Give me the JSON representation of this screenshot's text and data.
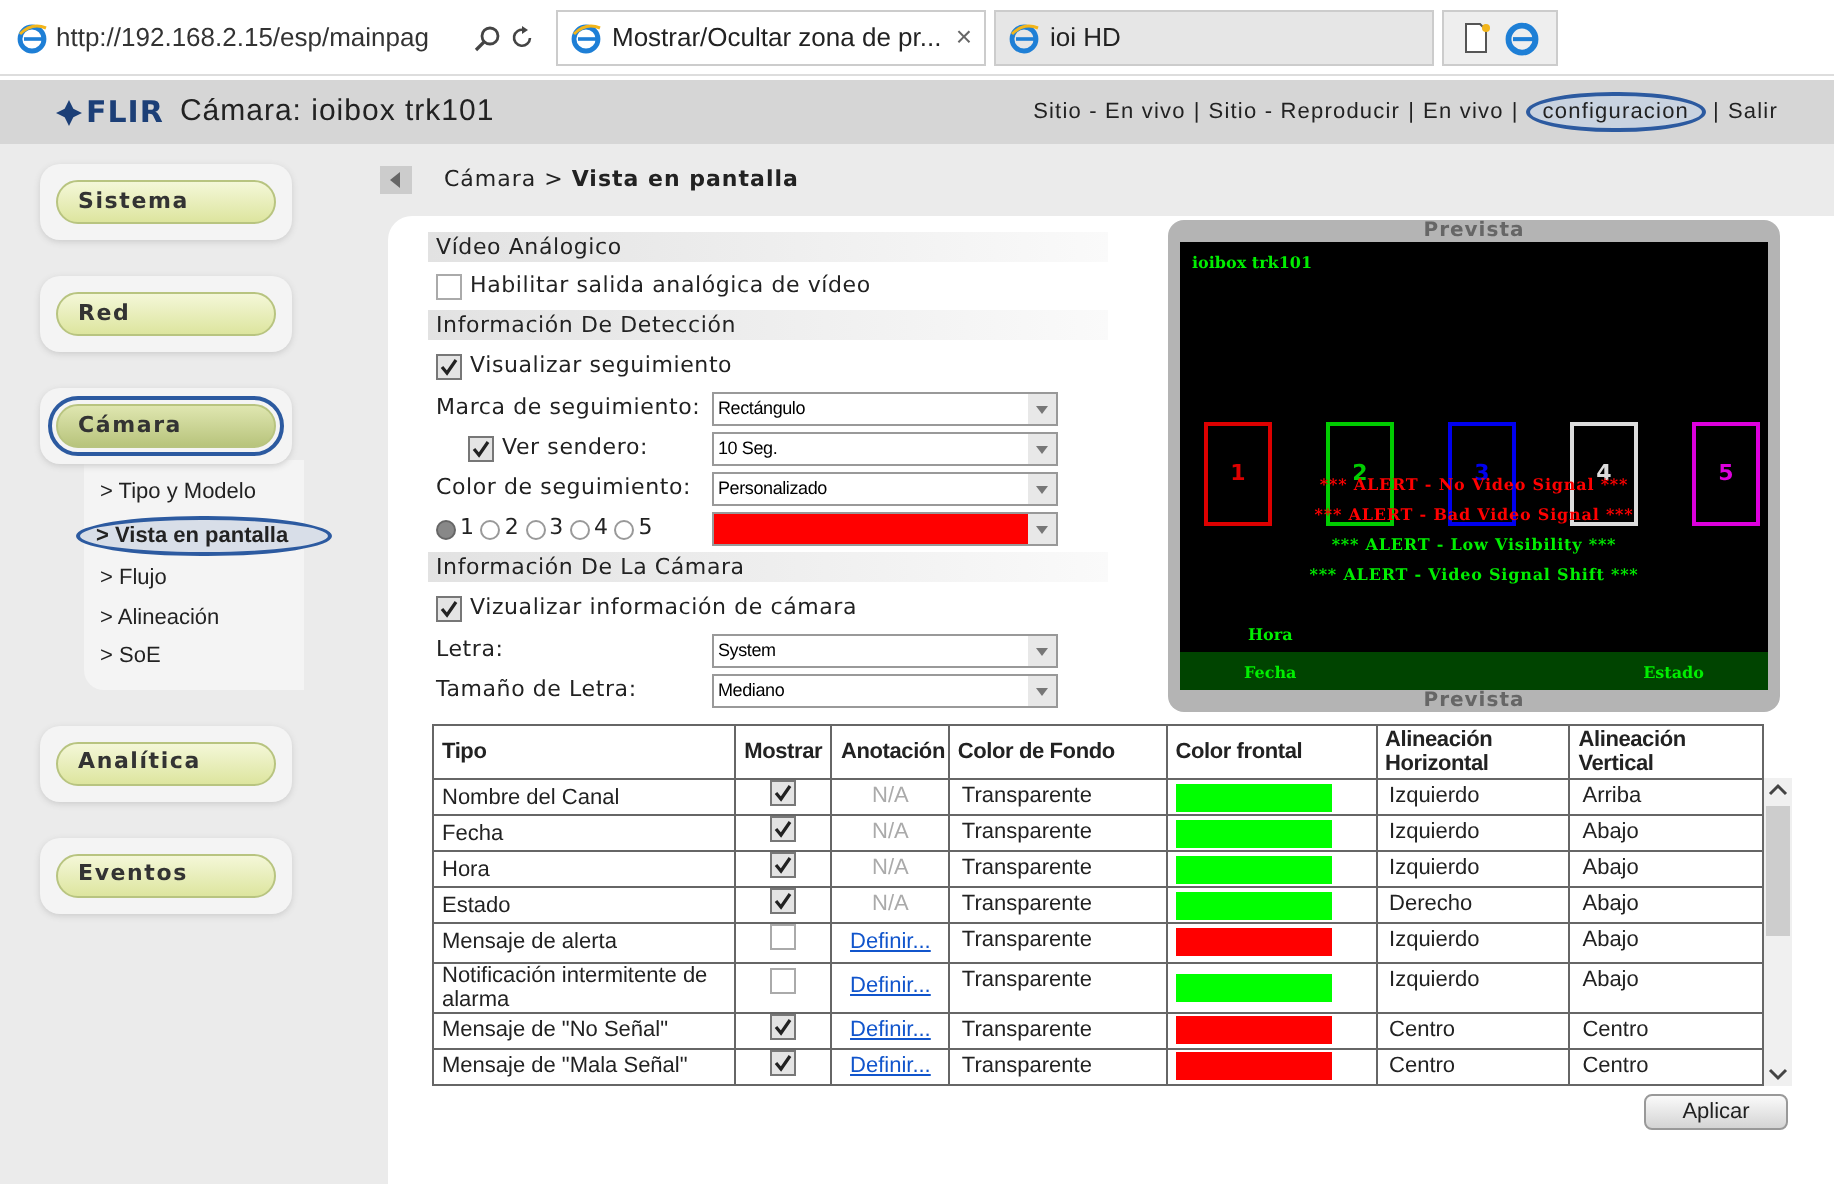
{
  "browser": {
    "address": "http://192.168.2.15/esp/mainpag",
    "tabs": [
      {
        "title": "Mostrar/Ocultar zona de pr...",
        "close": "×",
        "selected": true
      },
      {
        "title": "ioi HD",
        "selected": false
      }
    ]
  },
  "header": {
    "logo": "FLIR",
    "title": "Cámara: ioibox trk101",
    "separator": "|",
    "nav": [
      {
        "label": "Sitio - En vivo",
        "selected": false
      },
      {
        "label": "Sitio - Reproducir",
        "selected": false
      },
      {
        "label": "En vivo",
        "selected": false
      },
      {
        "label": "configuracion",
        "selected": true
      },
      {
        "label": "Salir",
        "selected": false
      }
    ]
  },
  "sidebar": {
    "items": [
      {
        "label": "Sistema",
        "selected": false
      },
      {
        "label": "Red",
        "selected": false
      },
      {
        "label": "Cámara",
        "selected": true,
        "children": [
          {
            "label": "Tipo y Modelo",
            "selected": false
          },
          {
            "label": "Vista en pantalla",
            "selected": true
          },
          {
            "label": "Flujo",
            "selected": false
          },
          {
            "label": "Alineación",
            "selected": false
          },
          {
            "label": "SoE",
            "selected": false
          }
        ]
      },
      {
        "label": "Analítica",
        "selected": false
      },
      {
        "label": "Eventos",
        "selected": false
      }
    ],
    "bullet": ">"
  },
  "breadcrumb": {
    "parent": "Cámara >",
    "current": "Vista en pantalla"
  },
  "analog": {
    "title": "Vídeo Análogico",
    "enable": {
      "label": "Habilitar salida analógica de vídeo",
      "checked": false
    }
  },
  "detection": {
    "title": "Información De Detección",
    "show_tracking": {
      "label": "Visualizar seguimiento",
      "checked": true
    },
    "mark": {
      "label": "Marca de seguimiento:",
      "value": "Rectángulo"
    },
    "trail": {
      "label": "Ver sendero:",
      "checked": true,
      "value": "10 Seg."
    },
    "color": {
      "label": "Color de seguimiento:",
      "value": "Personalizado"
    },
    "radios": [
      {
        "label": "1",
        "selected": true
      },
      {
        "label": "2",
        "selected": false
      },
      {
        "label": "3",
        "selected": false
      },
      {
        "label": "4",
        "selected": false
      },
      {
        "label": "5",
        "selected": false
      }
    ],
    "swatch": {
      "color": "#ff0000"
    }
  },
  "camera_info": {
    "title": "Información De La Cámara",
    "show": {
      "label": "Vizualizar información de cámara",
      "checked": true
    },
    "font": {
      "label": "Letra:",
      "value": "System"
    },
    "size": {
      "label": "Tamaño de Letra:",
      "value": "Mediano"
    }
  },
  "preview": {
    "title": "Prevista",
    "bottom_title": "Prevista",
    "channel_name": "ioibox trk101",
    "boxes": [
      {
        "label": "1",
        "color": "#dd0000"
      },
      {
        "label": "2",
        "color": "#00cc00"
      },
      {
        "label": "3",
        "color": "#0000ee"
      },
      {
        "label": "4",
        "color": "#dddddd"
      },
      {
        "label": "5",
        "color": "#dd00dd"
      }
    ],
    "alerts": [
      {
        "text": "*** ALERT - No Video Signal ***",
        "color": "#ff0000"
      },
      {
        "text": "*** ALERT - Bad Video Signal ***",
        "color": "#ff0000"
      },
      {
        "text": "*** ALERT - Low Visibility ***",
        "color": "#00ee00"
      },
      {
        "text": "*** ALERT - Video Signal Shift ***",
        "color": "#00ee00"
      }
    ],
    "hora": "Hora",
    "fecha": "Fecha",
    "estado": "Estado"
  },
  "table": {
    "columns": [
      "Tipo",
      "Mostrar",
      "Anotación",
      "Color de Fondo",
      "Color frontal",
      "Alineación Horizontal",
      "Alineación Vertical"
    ],
    "rows": [
      {
        "tipo": "Nombre del Canal",
        "checked": true,
        "annotation": {
          "kind": "na",
          "text": "N/A"
        },
        "background": "Transparente",
        "color": "#00ff00",
        "horizontal": "Izquierdo",
        "vertical": "Arriba"
      },
      {
        "tipo": "Fecha",
        "checked": true,
        "annotation": {
          "kind": "na",
          "text": "N/A"
        },
        "background": "Transparente",
        "color": "#00ff00",
        "horizontal": "Izquierdo",
        "vertical": "Abajo"
      },
      {
        "tipo": "Hora",
        "checked": true,
        "annotation": {
          "kind": "na",
          "text": "N/A"
        },
        "background": "Transparente",
        "color": "#00ff00",
        "horizontal": "Izquierdo",
        "vertical": "Abajo"
      },
      {
        "tipo": "Estado",
        "checked": true,
        "annotation": {
          "kind": "na",
          "text": "N/A"
        },
        "background": "Transparente",
        "color": "#00ff00",
        "horizontal": "Derecho",
        "vertical": "Abajo"
      },
      {
        "tipo": "Mensaje de alerta",
        "checked": false,
        "annotation": {
          "kind": "link",
          "text": "Definir..."
        },
        "background": "Transparente",
        "color": "#ff0000",
        "horizontal": "Izquierdo",
        "vertical": "Abajo"
      },
      {
        "tipo": "Notificación intermitente de alarma",
        "checked": false,
        "annotation": {
          "kind": "link",
          "text": "Definir..."
        },
        "background": "Transparente",
        "color": "#00ff00",
        "horizontal": "Izquierdo",
        "vertical": "Abajo"
      },
      {
        "tipo": "Mensaje de \"No Señal\"",
        "checked": true,
        "annotation": {
          "kind": "link",
          "text": "Definir..."
        },
        "background": "Transparente",
        "color": "#ff0000",
        "horizontal": "Centro",
        "vertical": "Centro"
      },
      {
        "tipo": "Mensaje de \"Mala Señal\"",
        "checked": true,
        "annotation": {
          "kind": "link",
          "text": "Definir..."
        },
        "background": "Transparente",
        "color": "#ff0000",
        "horizontal": "Centro",
        "vertical": "Centro"
      }
    ]
  },
  "apply": "Aplicar"
}
